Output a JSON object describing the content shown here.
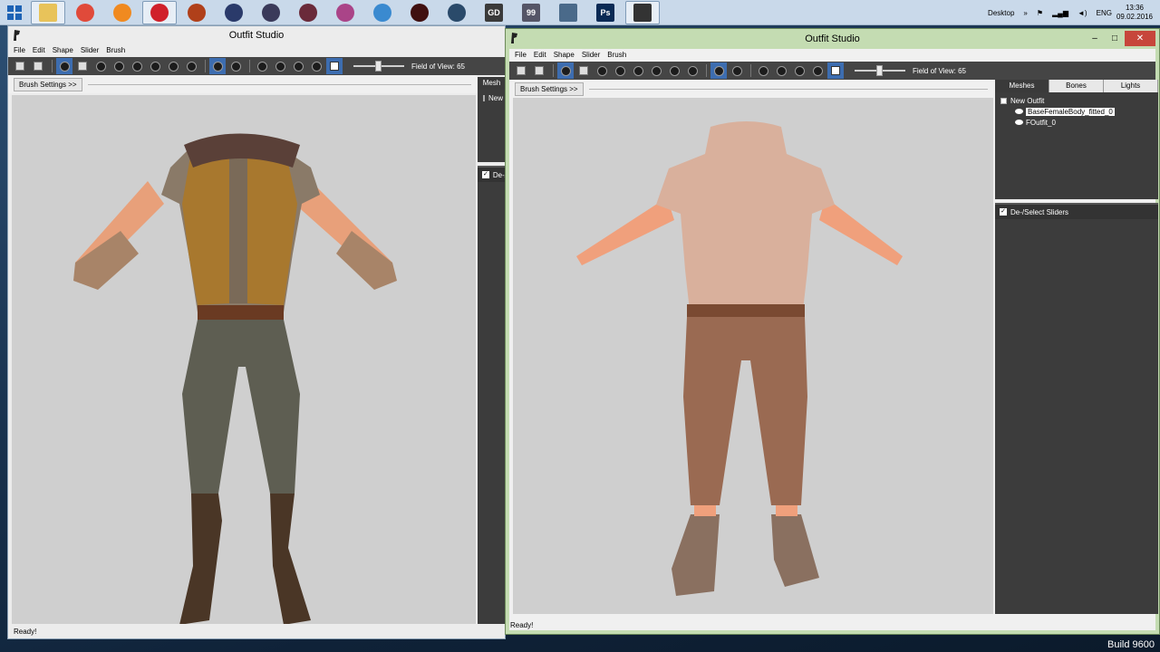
{
  "taskbar": {
    "apps": [
      {
        "name": "file-explorer",
        "label": "",
        "color": "#e8c35a",
        "active": true
      },
      {
        "name": "chrome",
        "label": "",
        "color": "#e04a3a",
        "active": false
      },
      {
        "name": "avast",
        "label": "",
        "color": "#f08a20",
        "active": false
      },
      {
        "name": "opera",
        "label": "",
        "color": "#d0202a",
        "active": true
      },
      {
        "name": "game1",
        "label": "",
        "color": "#b0401a",
        "active": false
      },
      {
        "name": "game2",
        "label": "",
        "color": "#2a3a6a",
        "active": false
      },
      {
        "name": "game3",
        "label": "",
        "color": "#3a3a5a",
        "active": false
      },
      {
        "name": "game4",
        "label": "",
        "color": "#6a2a3a",
        "active": false
      },
      {
        "name": "game5",
        "label": "",
        "color": "#aa4488",
        "active": false
      },
      {
        "name": "fallout",
        "label": "",
        "color": "#3a8ad0",
        "active": false
      },
      {
        "name": "sith",
        "label": "",
        "color": "#401010",
        "active": false
      },
      {
        "name": "game6",
        "label": "",
        "color": "#2a4a6a",
        "active": false
      },
      {
        "name": "gd",
        "label": "GD",
        "color": "#3a3a3a",
        "active": false
      },
      {
        "name": "app99",
        "label": "99",
        "color": "#556",
        "active": false
      },
      {
        "name": "window-app",
        "label": "",
        "color": "#4a6a8a",
        "active": false
      },
      {
        "name": "photoshop",
        "label": "Ps",
        "color": "#0a2a55",
        "active": false
      },
      {
        "name": "outfit-studio",
        "label": "",
        "color": "#333",
        "active": true
      }
    ],
    "desktop_label": "Desktop",
    "lang": "ENG",
    "time": "13:36",
    "date": "09.02.2016"
  },
  "desktop": {
    "build": "Build 9600"
  },
  "back_window": {
    "title": "Outfit Studio",
    "menu": [
      "File",
      "Edit",
      "Shape",
      "Slider",
      "Brush"
    ],
    "fov": "Field of View: 65",
    "brush_settings": "Brush Settings >>",
    "side_tab_partial": "Mesh",
    "tree_partial": "New",
    "sliders_partial": "De-/",
    "status": "Ready!"
  },
  "front_window": {
    "title": "Outfit Studio",
    "menu": [
      "File",
      "Edit",
      "Shape",
      "Slider",
      "Brush"
    ],
    "fov": "Field of View: 65",
    "brush_settings": "Brush Settings >>",
    "tabs": [
      "Meshes",
      "Bones",
      "Lights"
    ],
    "tree_root": "New Outfit",
    "meshes": [
      "BaseFemaleBody_fitted_0",
      "FOutfit_0"
    ],
    "sliders_header": "De-/Select Sliders",
    "status": "Ready!",
    "controls": {
      "minimize": "–",
      "maximize": "□",
      "close": "✕"
    }
  }
}
